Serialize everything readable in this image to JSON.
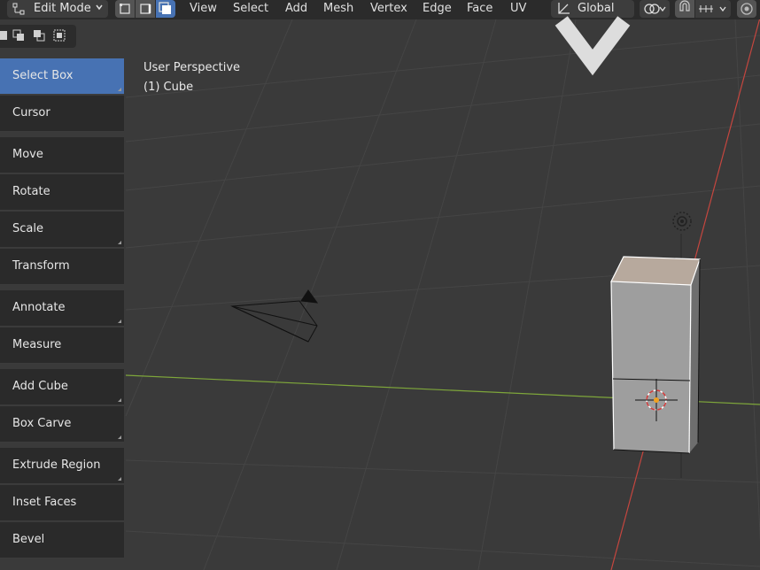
{
  "header": {
    "mode": "Edit Mode",
    "menus": [
      "View",
      "Select",
      "Add",
      "Mesh",
      "Vertex",
      "Edge",
      "Face",
      "UV"
    ],
    "orientation": "Global"
  },
  "toolbar": {
    "tools": [
      {
        "label": "Select Box",
        "active": true,
        "has_submenu": true
      },
      {
        "label": "Cursor",
        "active": false,
        "has_submenu": false
      },
      {
        "label": "Move",
        "active": false,
        "has_submenu": false
      },
      {
        "label": "Rotate",
        "active": false,
        "has_submenu": false
      },
      {
        "label": "Scale",
        "active": false,
        "has_submenu": true
      },
      {
        "label": "Transform",
        "active": false,
        "has_submenu": false
      },
      {
        "label": "Annotate",
        "active": false,
        "has_submenu": true
      },
      {
        "label": "Measure",
        "active": false,
        "has_submenu": false
      },
      {
        "label": "Add Cube",
        "active": false,
        "has_submenu": true
      },
      {
        "label": "Box Carve",
        "active": false,
        "has_submenu": true
      },
      {
        "label": "Extrude Region",
        "active": false,
        "has_submenu": true
      },
      {
        "label": "Inset Faces",
        "active": false,
        "has_submenu": false
      },
      {
        "label": "Bevel",
        "active": false,
        "has_submenu": false
      }
    ]
  },
  "viewport": {
    "view_name": "User Perspective",
    "object_name": "(1) Cube"
  },
  "colors": {
    "accent": "#4772b3",
    "x_axis": "#c5463f",
    "y_axis": "#7ea63a"
  }
}
